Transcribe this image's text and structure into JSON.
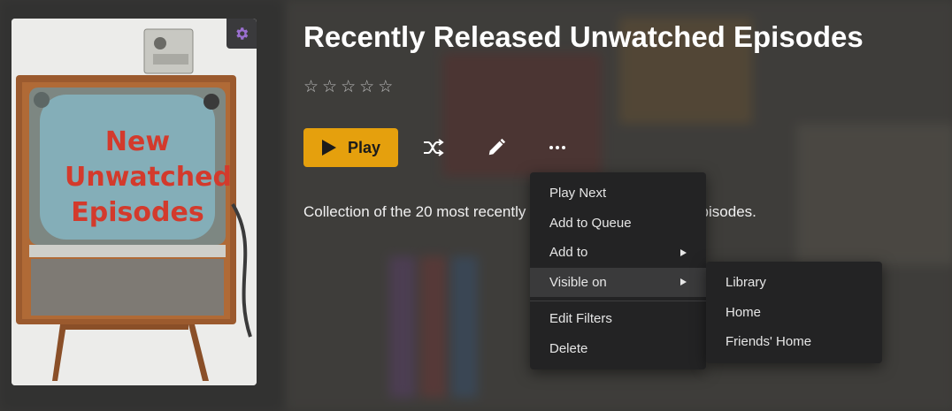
{
  "hub": {
    "title": "Recently Released Unwatched Episodes",
    "rating_stars": 5,
    "summary": "Collection of the 20 most recently released unwatched TV episodes."
  },
  "poster": {
    "line1": "New",
    "line2": "Unwatched",
    "line3": "Episodes",
    "settings_icon": "gear-icon"
  },
  "actions": {
    "play_label": "Play",
    "shuffle_icon": "shuffle-icon",
    "edit_icon": "pencil-icon",
    "more_icon": "more-horizontal-icon"
  },
  "menu": {
    "items": [
      "Play Next",
      "Add to Queue",
      "Add to",
      "Visible on",
      "Edit Filters",
      "Delete"
    ]
  },
  "submenu": {
    "items": [
      "Library",
      "Home",
      "Friends' Home"
    ]
  },
  "colors": {
    "accent": "#e5a00d",
    "menu_bg": "#232324"
  }
}
